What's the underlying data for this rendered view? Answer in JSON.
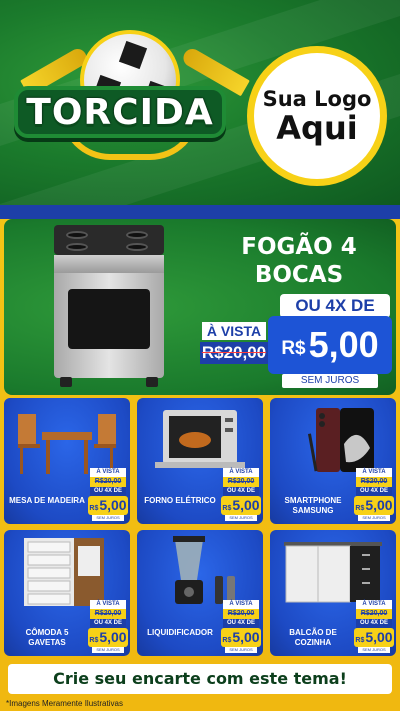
{
  "header": {
    "title": "TORCIDA",
    "logo_line1": "Sua Logo",
    "logo_line2": "Aqui"
  },
  "hero": {
    "title_line1": "FOGÃO 4",
    "title_line2": "BOCAS",
    "ou_4x": "OU 4X DE",
    "a_vista": "À VISTA",
    "old_price": "R$20,00",
    "currency": "R$",
    "price": "5,00",
    "sem_juros": "SEM JUROS"
  },
  "products": [
    {
      "name": "MESA DE MADEIRA",
      "a_vista": "À VISTA",
      "old_price": "R$20,00",
      "ou_4x": "OU 4X DE",
      "currency": "R$",
      "price": "5,00",
      "sem_juros": "SEM JUROS"
    },
    {
      "name": "FORNO ELÉTRICO",
      "a_vista": "À VISTA",
      "old_price": "R$20,00",
      "ou_4x": "OU 4X DE",
      "currency": "R$",
      "price": "5,00",
      "sem_juros": "SEM JUROS"
    },
    {
      "name": "SMARTPHONE SAMSUNG",
      "a_vista": "À VISTA",
      "old_price": "R$20,00",
      "ou_4x": "OU 4X DE",
      "currency": "R$",
      "price": "5,00",
      "sem_juros": "SEM JUROS"
    },
    {
      "name": "CÔMODA 5 GAVETAS",
      "a_vista": "À VISTA",
      "old_price": "R$20,00",
      "ou_4x": "OU 4X DE",
      "currency": "R$",
      "price": "5,00",
      "sem_juros": "SEM JUROS"
    },
    {
      "name": "LIQUIDIFICADOR",
      "a_vista": "À VISTA",
      "old_price": "R$20,00",
      "ou_4x": "OU 4X DE",
      "currency": "R$",
      "price": "5,00",
      "sem_juros": "SEM JUROS"
    },
    {
      "name": "BALCÃO DE COZINHA",
      "a_vista": "À VISTA",
      "old_price": "R$20,00",
      "ou_4x": "OU 4X DE",
      "currency": "R$",
      "price": "5,00",
      "sem_juros": "SEM JUROS"
    }
  ],
  "cta": "Crie seu encarte com este tema!",
  "disclaimer": "*Imagens Meramente Ilustrativas",
  "colors": {
    "green": "#1a7a2c",
    "yellow": "#f7d117",
    "blue": "#1d4ac4",
    "accent_blue": "#1d3fa8"
  },
  "icons": [
    "soccer-ball-icon",
    "vuvuzela-icon"
  ]
}
